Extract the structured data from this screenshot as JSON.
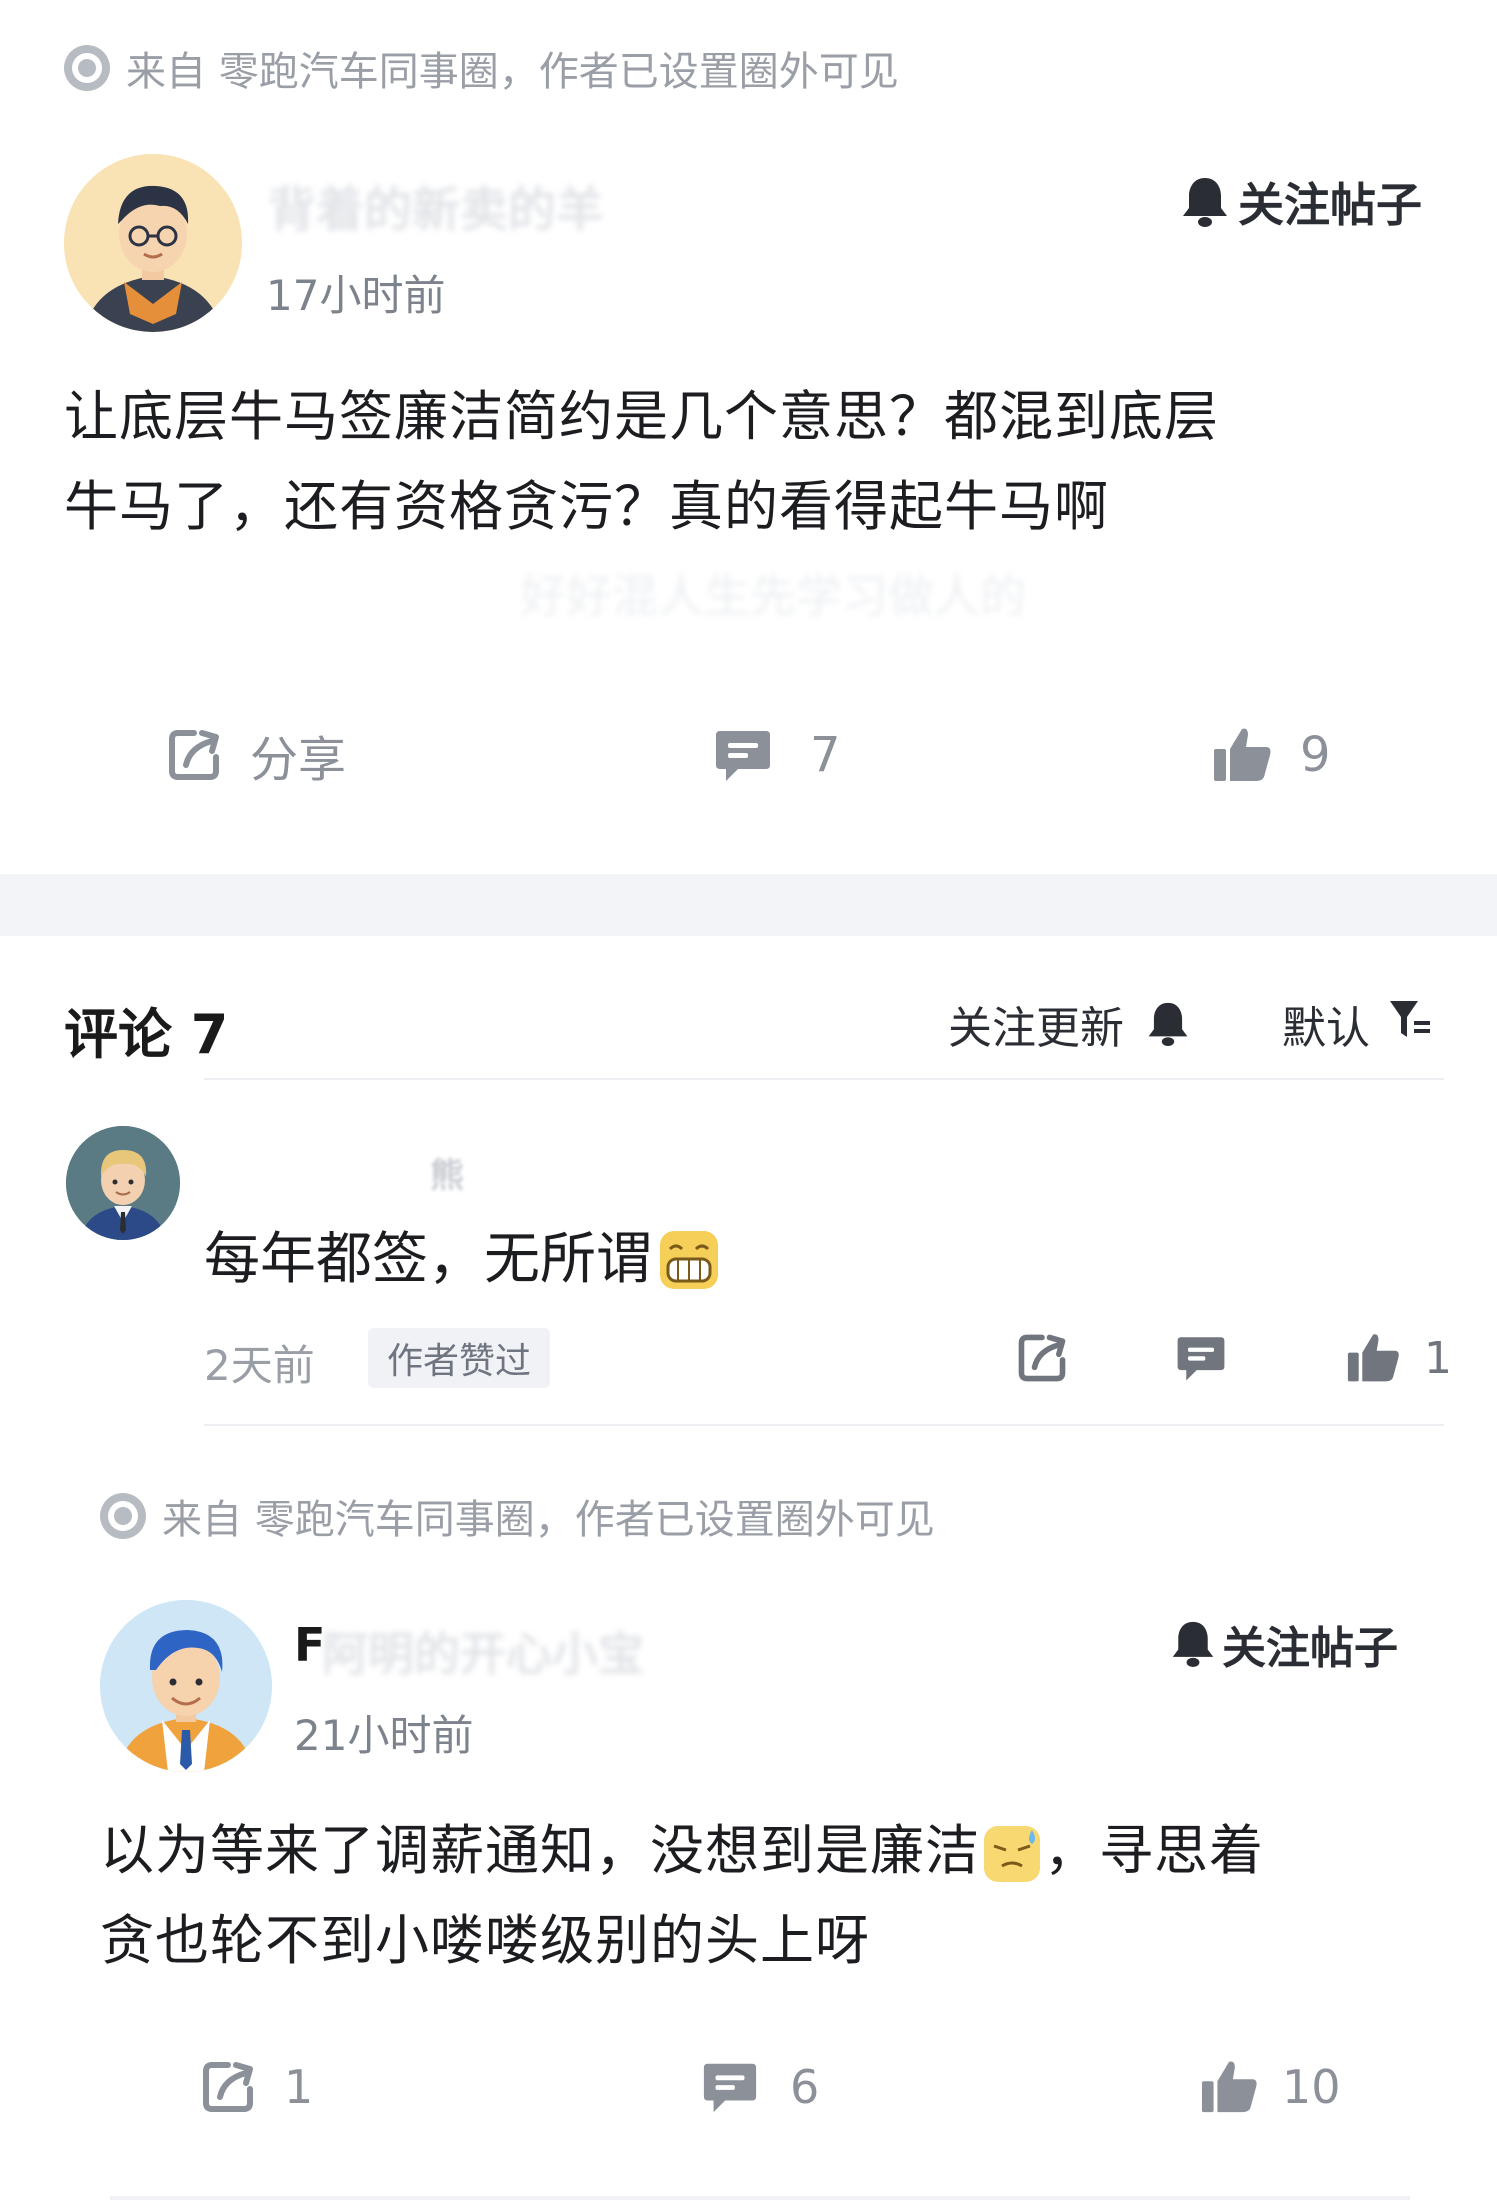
{
  "post": {
    "source_text": "来自 零跑汽车同事圈，作者已设置圈外可见",
    "author_name": "背着的新卖的羊",
    "time": "17小时前",
    "follow_label": "关注帖子",
    "body_line1": "让底层牛马签廉洁简约是几个意思？都混到底层",
    "body_line2": "牛马了，还有资格贪污？真的看得起牛马啊",
    "faded_line": "好好混人生先学习做人的",
    "share_label": "分享",
    "comment_count": "7",
    "like_count": "9"
  },
  "comments_header": {
    "title": "评论 7",
    "follow_updates": "关注更新",
    "sort_label": "默认"
  },
  "comment1": {
    "username": "熊",
    "text": "每年都签，无所谓",
    "time": "2天前",
    "badge": "作者赞过",
    "like_count": "1"
  },
  "post2": {
    "source_text": "来自 零跑汽车同事圈，作者已设置圈外可见",
    "author_initial": "F",
    "author_name": "阿明的开心小宝",
    "time": "21小时前",
    "follow_label": "关注帖子",
    "text_part1": "以为等来了调薪通知，没想到是廉洁",
    "text_part2": "，寻思着",
    "body_line2": "贪也轮不到小喽喽级别的头上呀",
    "share_count": "1",
    "comment_count": "6",
    "like_count": "10"
  },
  "icons": {
    "source": "circle-dot-icon",
    "bell": "bell-icon",
    "share": "share-icon",
    "comment": "comment-icon",
    "like": "thumbs-up-icon",
    "filter": "filter-icon",
    "grin_emoji": "grinning-emoji-icon",
    "sweat_emoji": "sweat-emoji-icon"
  },
  "colors": {
    "text_primary": "#1c1d20",
    "text_muted": "#8b9099",
    "icon_dark": "#2a2d33",
    "band": "#f3f4f7"
  }
}
